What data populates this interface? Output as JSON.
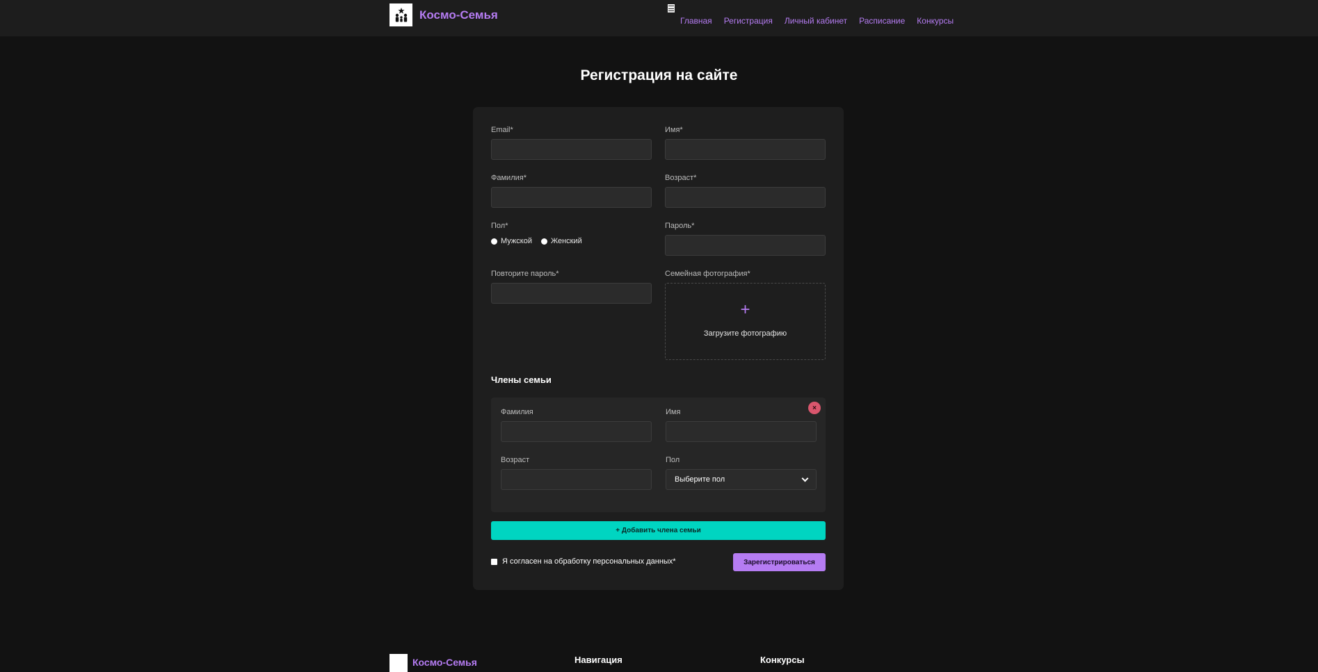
{
  "header": {
    "brand": "Космо-Семья",
    "nav": [
      "Главная",
      "Регистрация",
      "Личный кабинет",
      "Расписание",
      "Конкурсы"
    ]
  },
  "page": {
    "title": "Регистрация на сайте"
  },
  "form": {
    "email_label": "Email*",
    "first_name_label": "Имя*",
    "last_name_label": "Фамилия*",
    "age_label": "Возраст*",
    "gender_label": "Пол*",
    "gender_options": [
      "Мужской",
      "Женский"
    ],
    "password_label": "Пароль*",
    "repeat_password_label": "Повторите пароль*",
    "photo_label": "Семейная фотография*",
    "upload_plus": "+",
    "upload_text": "Загрузите фотографию"
  },
  "family": {
    "section_title": "Члены семьи",
    "remove_symbol": "×",
    "last_name_label": "Фамилия",
    "first_name_label": "Имя",
    "age_label": "Возраст",
    "gender_label": "Пол",
    "gender_select_value": "Выберите пол",
    "add_button": "+ Добавить члена семьи"
  },
  "consent": {
    "label": "Я согласен на обработку персональных данных*"
  },
  "submit": {
    "label": "Зарегистрироваться"
  },
  "footer": {
    "brand": "Космо-Семья",
    "headings": [
      "Навигация",
      "Конкурсы"
    ]
  },
  "colors": {
    "accent": "#b57cf2",
    "teal": "#00d5c1",
    "danger": "#d9566d",
    "background": "#121212",
    "card": "#1e1e1e"
  }
}
